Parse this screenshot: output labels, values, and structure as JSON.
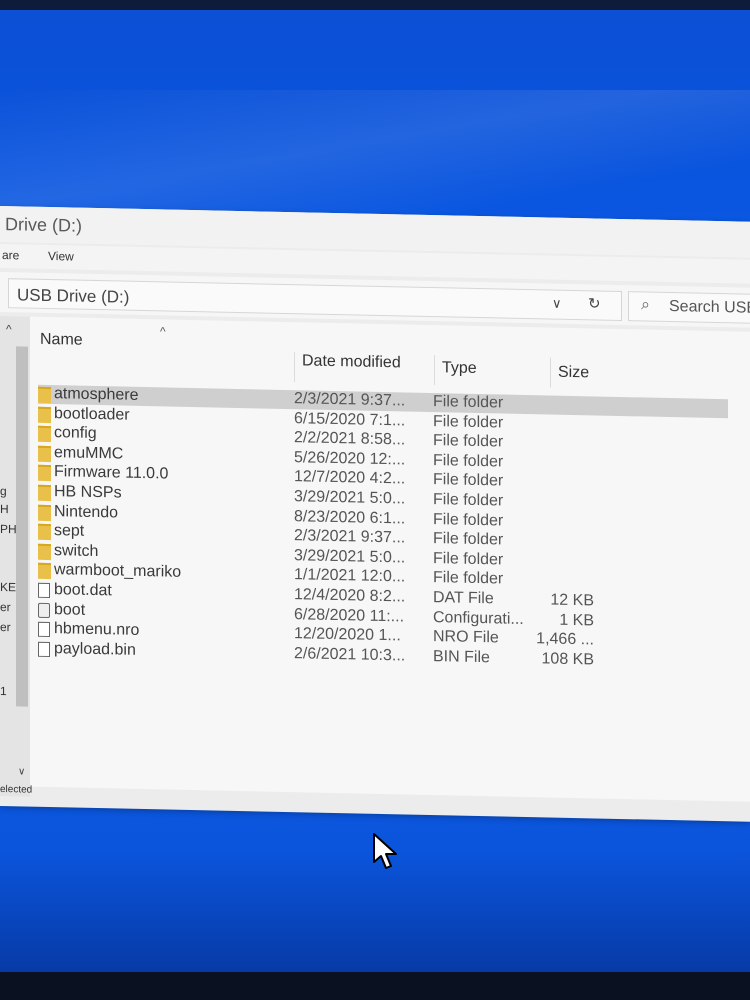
{
  "window": {
    "title": "Drive (D:)",
    "ribbon_tabs": [
      "are",
      "View"
    ],
    "address": "USB Drive (D:)",
    "search_placeholder": "Search USB",
    "status": "elected"
  },
  "nav_fragments": [
    "g",
    "H",
    "PH",
    "KE",
    "er",
    "er",
    "1"
  ],
  "columns": [
    "Name",
    "Date modified",
    "Type",
    "Size"
  ],
  "files": [
    {
      "name": "atmosphere",
      "date": "2/3/2021 9:37...",
      "type": "File folder",
      "size": "",
      "icon": "folder-icon",
      "selected": true
    },
    {
      "name": "bootloader",
      "date": "6/15/2020 7:1...",
      "type": "File folder",
      "size": "",
      "icon": "folder-icon",
      "selected": false
    },
    {
      "name": "config",
      "date": "2/2/2021 8:58...",
      "type": "File folder",
      "size": "",
      "icon": "folder-icon",
      "selected": false
    },
    {
      "name": "emuMMC",
      "date": "5/26/2020 12:...",
      "type": "File folder",
      "size": "",
      "icon": "folder-icon",
      "selected": false
    },
    {
      "name": "Firmware 11.0.0",
      "date": "12/7/2020 4:2...",
      "type": "File folder",
      "size": "",
      "icon": "folder-icon",
      "selected": false
    },
    {
      "name": "HB NSPs",
      "date": "3/29/2021 5:0...",
      "type": "File folder",
      "size": "",
      "icon": "folder-icon",
      "selected": false
    },
    {
      "name": "Nintendo",
      "date": "8/23/2020 6:1...",
      "type": "File folder",
      "size": "",
      "icon": "folder-icon",
      "selected": false
    },
    {
      "name": "sept",
      "date": "2/3/2021 9:37...",
      "type": "File folder",
      "size": "",
      "icon": "folder-icon",
      "selected": false
    },
    {
      "name": "switch",
      "date": "3/29/2021 5:0...",
      "type": "File folder",
      "size": "",
      "icon": "folder-icon",
      "selected": false
    },
    {
      "name": "warmboot_mariko",
      "date": "1/1/2021 12:0...",
      "type": "File folder",
      "size": "",
      "icon": "folder-icon",
      "selected": false
    },
    {
      "name": "boot.dat",
      "date": "12/4/2020 8:2...",
      "type": "DAT File",
      "size": "12 KB",
      "icon": "file-icon",
      "selected": false
    },
    {
      "name": "boot",
      "date": "6/28/2020 11:...",
      "type": "Configurati...",
      "size": "1 KB",
      "icon": "config-file-icon",
      "selected": false
    },
    {
      "name": "hbmenu.nro",
      "date": "12/20/2020 1...",
      "type": "NRO File",
      "size": "1,466 ...",
      "icon": "file-icon",
      "selected": false
    },
    {
      "name": "payload.bin",
      "date": "2/6/2021 10:3...",
      "type": "BIN File",
      "size": "108 KB",
      "icon": "file-icon",
      "selected": false
    }
  ],
  "icons": {
    "up": "^",
    "sort": "^",
    "chevron": "∨",
    "refresh": "↻",
    "search": "⌕",
    "scroll_down": "∨"
  },
  "colors": {
    "desktop": "#0a56e0",
    "selection": "#cfcfcf",
    "folder": "#e8c04a"
  }
}
